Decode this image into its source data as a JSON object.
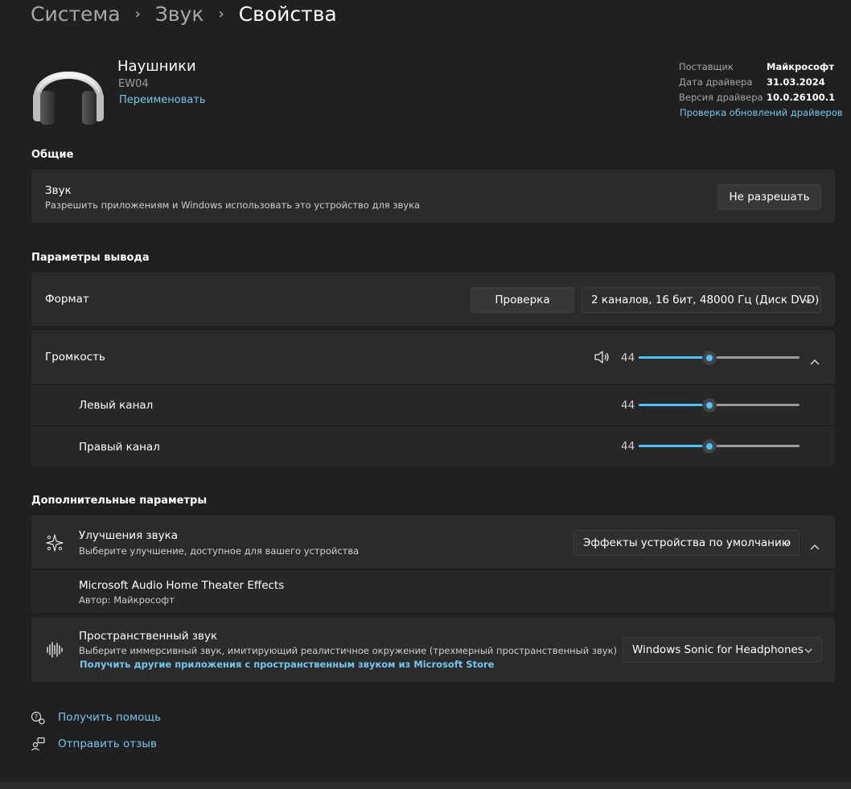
{
  "breadcrumb": {
    "level1": "Система",
    "level2": "Звук",
    "current": "Свойства",
    "separator": "›"
  },
  "device": {
    "icon": "headphones-icon",
    "name": "Наушники",
    "model": "EW04",
    "rename_link": "Переименовать"
  },
  "driver": {
    "provider_label": "Поставщик",
    "provider_value": "Майкрософт",
    "date_label": "Дата драйвера",
    "date_value": "31.03.2024",
    "version_label": "Версия драйвера",
    "version_value": "10.0.26100.1",
    "update_link": "Проверка обновлений драйверов"
  },
  "general": {
    "section_title": "Общие",
    "sound_title": "Звук",
    "sound_desc": "Разрешить приложениям и Windows использовать это устройство для звука",
    "sound_button": "Не разрешать"
  },
  "output": {
    "section_title": "Параметры вывода",
    "format_label": "Формат",
    "test_button": "Проверка",
    "format_value": "2 каналов, 16 бит, 48000 Гц (Диск DVD)",
    "volume_label": "Громкость",
    "volume_value": "44",
    "left_label": "Левый канал",
    "left_value": "44",
    "right_label": "Правый канал",
    "right_value": "44"
  },
  "advanced": {
    "section_title": "Дополнительные параметры",
    "enhance_title": "Улучшения звука",
    "enhance_desc": "Выберите улучшение, доступное для вашего устройства",
    "enhance_value": "Эффекты устройства по умолчанию",
    "effect_title": "Microsoft Audio Home Theater Effects",
    "effect_author": "Автор: Майкрософт",
    "spatial_title": "Пространственный звук",
    "spatial_desc": "Выберите иммерсивный звук, имитирующий реалистичное окружение (трехмерный пространственный звук)",
    "spatial_link": "Получить другие приложения с пространственным звуком из Microsoft Store",
    "spatial_value": "Windows Sonic for Headphones"
  },
  "footer": {
    "help_link": "Получить помощь",
    "feedback_link": "Отправить отзыв"
  },
  "colors": {
    "accent": "#4cc2ff",
    "link": "#75c6ee",
    "background": "#202020",
    "card": "#2b2b2b"
  }
}
